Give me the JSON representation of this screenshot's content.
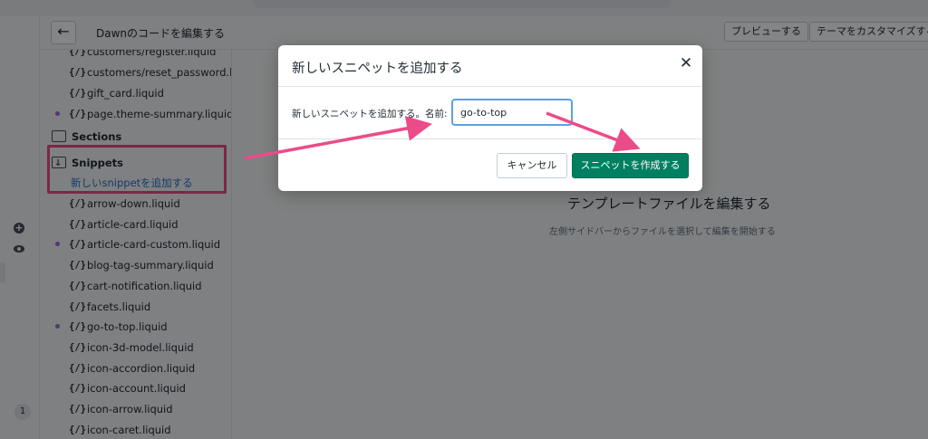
{
  "header": {
    "title": "Dawnのコードを編集する",
    "preview_label": "プレビューする",
    "customize_label": "テーマをカスタマイズする"
  },
  "rail": {
    "notification_count": "1"
  },
  "sidebar": {
    "top_files": [
      {
        "name": "customers/register.liquid",
        "modified": false
      },
      {
        "name": "customers/reset_password.liquid",
        "modified": false
      },
      {
        "name": "gift_card.liquid",
        "modified": false
      },
      {
        "name": "page.theme-summary.liquid",
        "modified": true
      }
    ],
    "sections_label": "Sections",
    "snippets_label": "Snippets",
    "add_snippet_label": "新しいsnippetを追加する",
    "snippet_files": [
      {
        "name": "arrow-down.liquid",
        "modified": false
      },
      {
        "name": "article-card.liquid",
        "modified": false
      },
      {
        "name": "article-card-custom.liquid",
        "modified": true
      },
      {
        "name": "blog-tag-summary.liquid",
        "modified": false
      },
      {
        "name": "cart-notification.liquid",
        "modified": false
      },
      {
        "name": "facets.liquid",
        "modified": false
      },
      {
        "name": "go-to-top.liquid",
        "modified": true
      },
      {
        "name": "icon-3d-model.liquid",
        "modified": false
      },
      {
        "name": "icon-accordion.liquid",
        "modified": false
      },
      {
        "name": "icon-account.liquid",
        "modified": false
      },
      {
        "name": "icon-arrow.liquid",
        "modified": false
      },
      {
        "name": "icon-caret.liquid",
        "modified": false
      }
    ],
    "file_icon_glyph": "{/}"
  },
  "main": {
    "empty_title": "テンプレートファイルを編集する",
    "empty_subtitle": "左側サイドバーからファイルを選択して編集を開始する"
  },
  "modal": {
    "title": "新しいスニペットを追加する",
    "name_label": "新しいスニペットを追加する。名前:",
    "name_value": "go-to-top",
    "cancel_label": "キャンセル",
    "create_label": "スニペットを作成する"
  },
  "colors": {
    "annotation": "#ec4b8a",
    "primary": "#008060",
    "link": "#2c6ecb",
    "modified_dot": "#9c6ade"
  },
  "icons": {
    "back": "arrow-left-icon",
    "close": "close-icon",
    "folder": "folder-icon",
    "file": "liquid-file-icon"
  }
}
